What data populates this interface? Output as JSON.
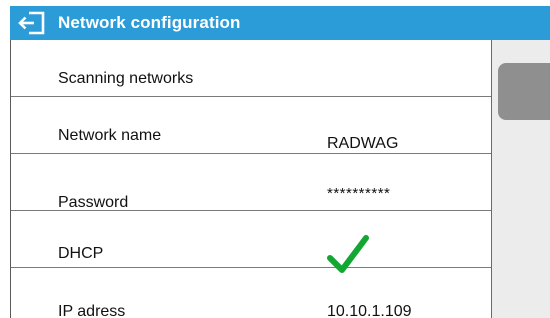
{
  "header": {
    "title": "Network configuration",
    "back_icon": "exit-arrow-icon",
    "color": "#2c9cd9"
  },
  "settings": {
    "scanning_label": "Scanning networks",
    "network_name_label": "Network name",
    "network_name_value": "RADWAG",
    "password_label": "Password",
    "password_value": "**********",
    "dhcp_label": "DHCP",
    "dhcp_icon": "checkmark-icon",
    "dhcp_enabled": true,
    "ip_label": "IP adress",
    "ip_value": "10.10.1.109"
  },
  "colors": {
    "check": "#12a632",
    "scroll_thumb": "#8f8f8f",
    "scroll_track": "#ececec"
  }
}
